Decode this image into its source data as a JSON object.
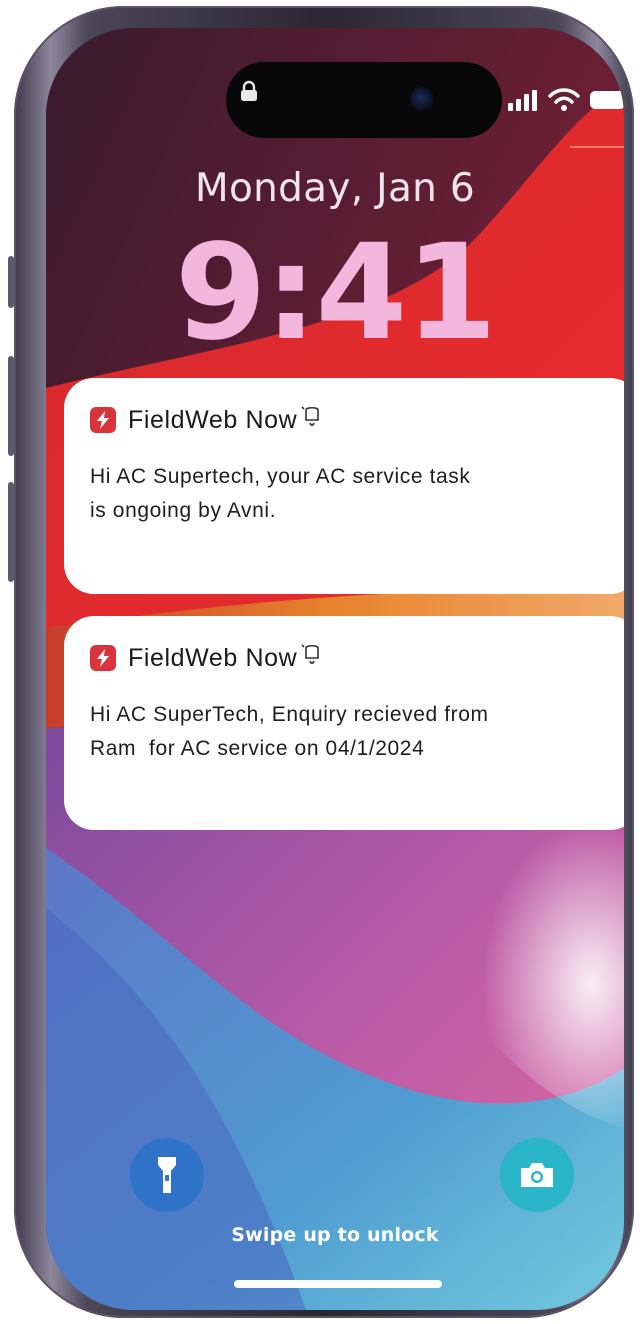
{
  "lock_screen": {
    "date": "Monday, Jan 6",
    "time": "9:41",
    "swipe_hint": "Swipe up to unlock"
  },
  "status_bar": {
    "icons": [
      "lock-icon",
      "signal-icon",
      "wifi-icon",
      "battery-icon"
    ]
  },
  "notifications": [
    {
      "app_name": "FieldWeb Now",
      "icon": "fieldweb-logo-icon",
      "badge_icon": "bell-icon",
      "line1": "Hi AC Supertech, your AC service task",
      "line2": "is ongoing by Avni."
    },
    {
      "app_name": "FieldWeb Now",
      "icon": "fieldweb-logo-icon",
      "badge_icon": "bell-icon",
      "line1": "Hi AC SuperTech, Enquiry recieved from",
      "line2": "Ram  for AC service on 04/1/2024"
    }
  ],
  "quick_actions": {
    "left": "flashlight-icon",
    "right": "camera-icon"
  },
  "colors": {
    "notification_bg": "#ffffff",
    "app_icon": "#d9343c",
    "time_text": "#f3b6dd",
    "flashlight_button": "#2f73c9",
    "camera_button": "#2ab5c8"
  }
}
